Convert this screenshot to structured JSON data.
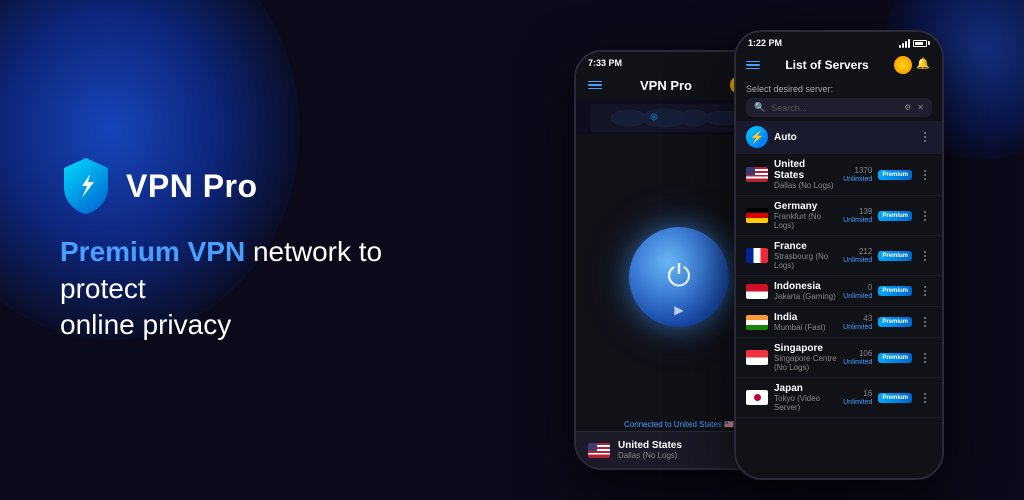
{
  "background": {
    "color": "#0a0a1a"
  },
  "left_panel": {
    "logo": {
      "text": "VPN Pro",
      "shield_color": "#00d4ff"
    },
    "tagline_line1": "Premium VPN network to protect",
    "tagline_line2": "online privacy"
  },
  "phone1": {
    "status_bar": {
      "time": "7:33 PM",
      "signal": "●●●",
      "wifi": "WiFi",
      "battery": "100"
    },
    "header": {
      "title": "VPN Pro"
    },
    "power_button": {
      "label": "⏻"
    },
    "connected_text": "Connected to United States",
    "country": {
      "name": "United States",
      "city": "Dallas (No Logs)"
    }
  },
  "phone2": {
    "status_bar": {
      "time": "1:22 PM"
    },
    "header": {
      "title": "List of Servers"
    },
    "select_text": "Select desired server:",
    "search_placeholder": "Search...",
    "servers": [
      {
        "name": "Auto",
        "city": "",
        "flag": "auto",
        "count": "",
        "load": "",
        "badge": ""
      },
      {
        "name": "United States",
        "city": "Dallas (No Logs)",
        "flag": "us",
        "count": "1370",
        "load": "Unlimited",
        "badge": "Premium"
      },
      {
        "name": "Germany",
        "city": "Frankfurt (No Logs)",
        "flag": "de",
        "count": "139",
        "load": "Unlimited",
        "badge": "Premium"
      },
      {
        "name": "France",
        "city": "Strasbourg (No Logs)",
        "flag": "fr",
        "count": "212",
        "load": "Unlimited",
        "badge": "Premium"
      },
      {
        "name": "Indonesia",
        "city": "Jakarta (Gaming)",
        "flag": "id",
        "count": "0",
        "load": "Unlimited",
        "badge": "Premium"
      },
      {
        "name": "India",
        "city": "Mumbai (Fast)",
        "flag": "in",
        "count": "43",
        "load": "Unlimited",
        "badge": "Premium"
      },
      {
        "name": "Singapore",
        "city": "Singapore Centre (No Logs)",
        "flag": "sg",
        "count": "106",
        "load": "Unlimited",
        "badge": "Premium"
      },
      {
        "name": "Japan",
        "city": "Tokyo (Video Server)",
        "flag": "jp",
        "count": "16",
        "load": "Unlimited",
        "badge": "Premium"
      }
    ]
  }
}
